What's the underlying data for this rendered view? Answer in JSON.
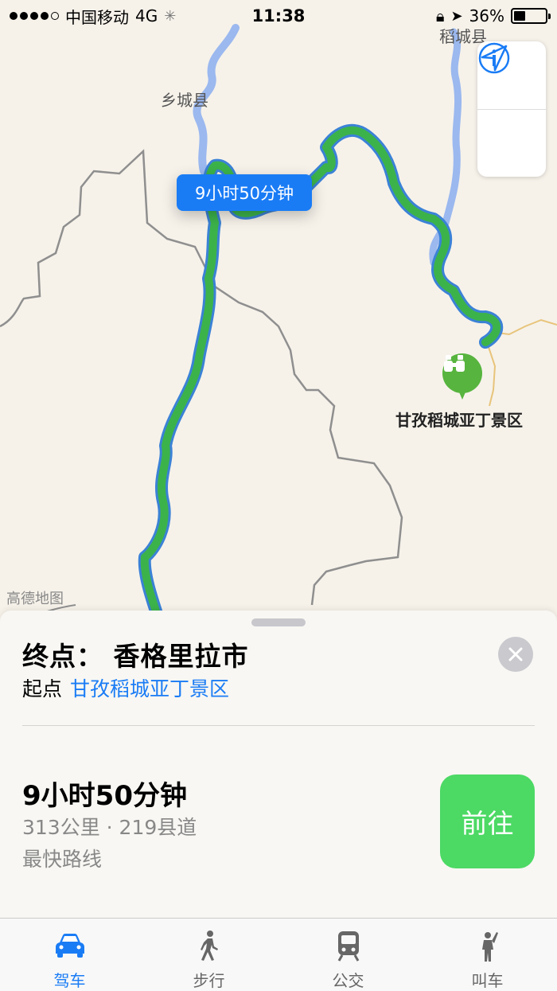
{
  "status_bar": {
    "carrier": "中国移动",
    "network": "4G",
    "time": "11:38",
    "battery": "36%",
    "battery_level": 0.36
  },
  "map": {
    "place_label": "乡城县",
    "place_label_top": "稻城县",
    "route_time_bubble": "9小时50分钟",
    "poi_name": "甘孜稻城亚丁景区",
    "watermark": "高德地图",
    "route_color": "#3cb34a",
    "route_outline_color": "#3b82d6"
  },
  "card": {
    "destination": "终点：  香格里拉市",
    "origin_prefix": "起点",
    "origin_name": "甘孜稻城亚丁景区",
    "duration": "9小时50分钟",
    "distance": "313公里 · 219县道",
    "route_type": "最快路线",
    "go_label": "前往"
  },
  "tabs": [
    {
      "label": "驾车",
      "active": true,
      "icon": "car-icon"
    },
    {
      "label": "步行",
      "active": false,
      "icon": "walk-icon"
    },
    {
      "label": "公交",
      "active": false,
      "icon": "transit-icon"
    },
    {
      "label": "叫车",
      "active": false,
      "icon": "hail-icon"
    }
  ],
  "colors": {
    "accent": "#1a7cf5",
    "go_green": "#4cd964",
    "poi_green": "#57b43e"
  }
}
